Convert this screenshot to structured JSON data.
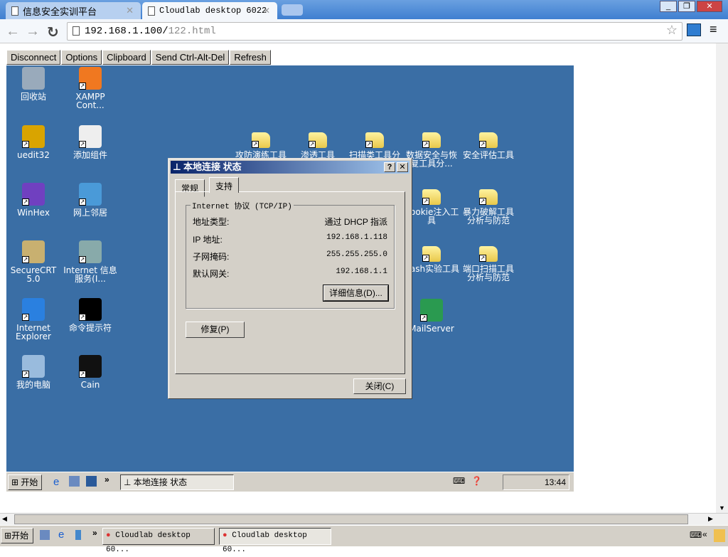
{
  "browser": {
    "tabs": [
      {
        "label": "信息安全实训平台"
      },
      {
        "label": "Cloudlab desktop 6022"
      }
    ],
    "url_host": "192.168.1.100/",
    "url_path": "122.html"
  },
  "vnc_toolbar": [
    "Disconnect",
    "Options",
    "Clipboard",
    "Send Ctrl-Alt-Del",
    "Refresh"
  ],
  "desktop_icons": [
    {
      "label": "回收站",
      "icon": "recycle-bin"
    },
    {
      "label": "XAMPP Cont...",
      "icon": "xampp"
    },
    {
      "label": "uedit32",
      "icon": "ultraedit"
    },
    {
      "label": "添加组件",
      "icon": "add-components"
    },
    {
      "label": "WinHex",
      "icon": "winhex"
    },
    {
      "label": "网上邻居",
      "icon": "network-places"
    },
    {
      "label": "SecureCRT 5.0",
      "icon": "securecrt"
    },
    {
      "label": "Internet 信息服务(I...",
      "icon": "iis"
    },
    {
      "label": "Internet Explorer",
      "icon": "ie"
    },
    {
      "label": "命令提示符",
      "icon": "cmd"
    },
    {
      "label": "我的电脑",
      "icon": "my-computer"
    },
    {
      "label": "Cain",
      "icon": "cain"
    },
    {
      "label": "攻防演练工具",
      "icon": "folder"
    },
    {
      "label": "渗透工具",
      "icon": "folder"
    },
    {
      "label": "扫描类工具分",
      "icon": "folder"
    },
    {
      "label": "数据安全与恢复工具分...",
      "icon": "folder"
    },
    {
      "label": "安全评估工具",
      "icon": "folder"
    },
    {
      "label": "Cookie注入工具",
      "icon": "folder"
    },
    {
      "label": "暴力破解工具分析与防范",
      "icon": "folder"
    },
    {
      "label": "Hash实验工具",
      "icon": "folder"
    },
    {
      "label": "端口扫描工具分析与防范",
      "icon": "folder"
    },
    {
      "label": "MailServer",
      "icon": "mailserver"
    }
  ],
  "dialog": {
    "title": "本地连接 状态",
    "tabs": [
      "常规",
      "支持"
    ],
    "group": "Internet 协议 (TCP/IP)",
    "rows": [
      {
        "label": "地址类型:",
        "value": "通过 DHCP 指派"
      },
      {
        "label": "IP 地址:",
        "value": "192.168.1.118"
      },
      {
        "label": "子网掩码:",
        "value": "255.255.255.0"
      },
      {
        "label": "默认网关:",
        "value": "192.168.1.1"
      }
    ],
    "details_button": "详细信息(D)...",
    "repair_button": "修复(P)",
    "close_button": "关闭(C)"
  },
  "remote_taskbar": {
    "start": "开始",
    "task": "本地连接 状态",
    "clock": "13:44"
  },
  "local_taskbar": {
    "start": "开始",
    "tasks": [
      "Cloudlab desktop 60...",
      "Cloudlab desktop 60..."
    ]
  }
}
